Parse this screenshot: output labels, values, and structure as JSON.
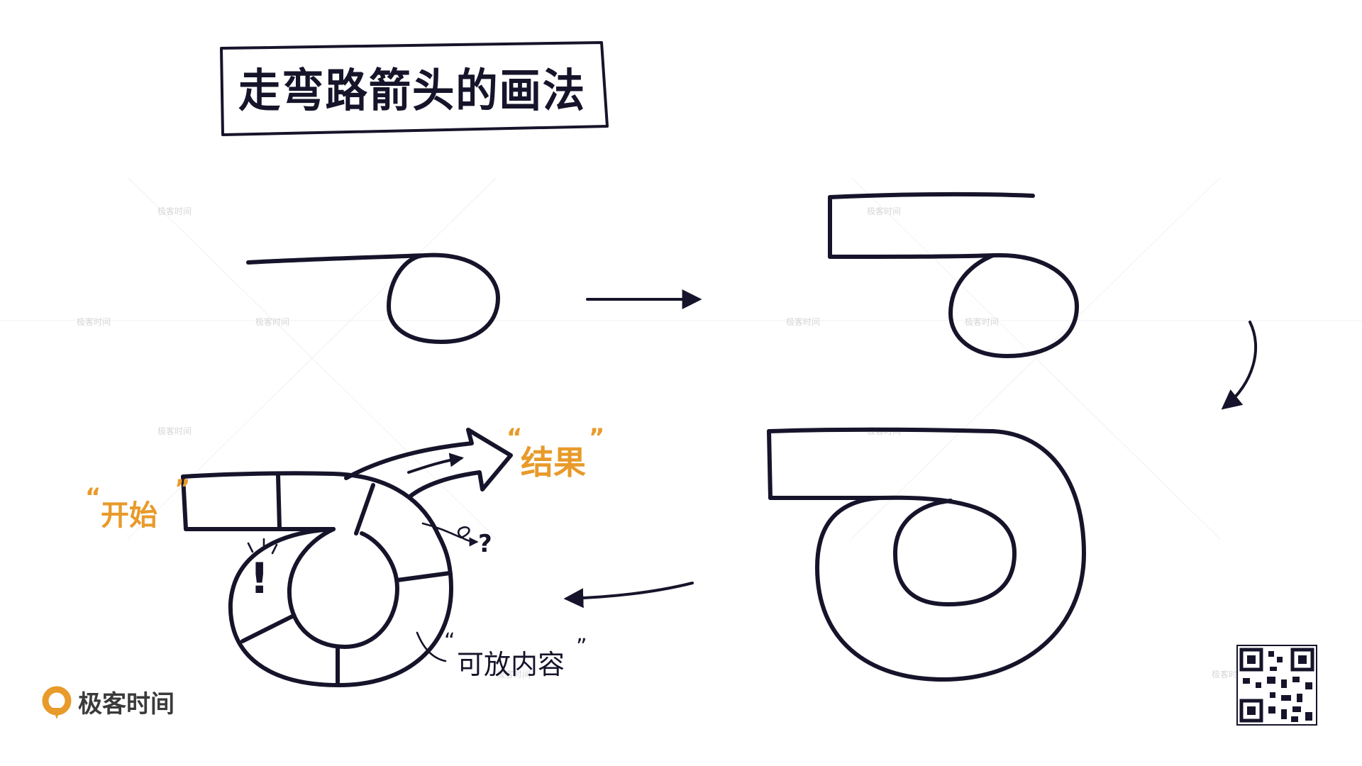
{
  "title": "走弯路箭头的画法",
  "labels": {
    "start": "开始",
    "result": "结果",
    "content": "可放内容",
    "question": "?",
    "exclaim": "!",
    "quote_open": "“",
    "quote_close": "”"
  },
  "brand": {
    "name": "极客时间",
    "color_orange": "#e89a2a",
    "ink_color": "#16142a"
  },
  "watermark": "极客时间",
  "icons": {
    "logo": "geektime-logo-icon",
    "qr": "qr-code-icon"
  }
}
